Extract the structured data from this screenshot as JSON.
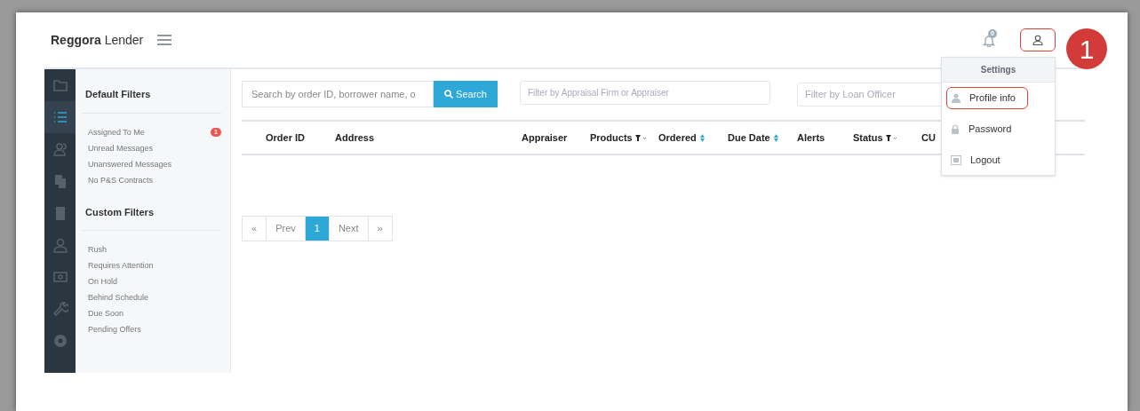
{
  "header": {
    "brand_bold": "Reggora",
    "brand_light": "Lender",
    "notification_count": "0"
  },
  "rail": [
    {
      "selected": false
    },
    {
      "selected": true
    },
    {
      "selected": false
    },
    {
      "selected": false
    },
    {
      "selected": false
    },
    {
      "selected": false
    },
    {
      "selected": false
    },
    {
      "selected": false
    },
    {
      "selected": false
    }
  ],
  "filters": {
    "default_title": "Default Filters",
    "default_items": [
      {
        "label": "Assigned To Me",
        "badge": "1"
      },
      {
        "label": "Unread Messages"
      },
      {
        "label": "Unanswered Messages"
      },
      {
        "label": "No P&S Contracts"
      }
    ],
    "custom_title": "Custom Filters",
    "custom_items": [
      {
        "label": "Rush"
      },
      {
        "label": "Requires Attention"
      },
      {
        "label": "On Hold"
      },
      {
        "label": "Behind Schedule"
      },
      {
        "label": "Due Soon"
      },
      {
        "label": "Pending Offers"
      }
    ]
  },
  "search": {
    "placeholder": "Search by order ID, borrower name, o",
    "button": "Search"
  },
  "appraiser_filter": {
    "placeholder": "Filter by Appraisal Firm or Appraiser"
  },
  "officer_filter": {
    "placeholder": "Filter by Loan Officer"
  },
  "table": {
    "columns": [
      {
        "label": "Order ID",
        "kind": "plain"
      },
      {
        "label": "Address",
        "kind": "plain"
      },
      {
        "label": "Appraiser",
        "kind": "plain"
      },
      {
        "label": "Products",
        "kind": "filter"
      },
      {
        "label": "Ordered",
        "kind": "sort"
      },
      {
        "label": "Due Date",
        "kind": "sort"
      },
      {
        "label": "Alerts",
        "kind": "plain"
      },
      {
        "label": "Status",
        "kind": "filter"
      },
      {
        "label": "CU",
        "kind": "plain"
      }
    ]
  },
  "pagination": [
    {
      "label": "«",
      "selected": false
    },
    {
      "label": "Prev",
      "selected": false
    },
    {
      "label": "1",
      "selected": true
    },
    {
      "label": "Next",
      "selected": false
    },
    {
      "label": "»",
      "selected": false
    }
  ],
  "menu": {
    "title": "Settings",
    "items": [
      {
        "label": "Profile info",
        "kind": "profile",
        "highlighted": true
      },
      {
        "label": "Password",
        "kind": "lock",
        "highlighted": false
      },
      {
        "label": "Logout",
        "kind": "logout",
        "highlighted": false
      }
    ]
  },
  "profile_button": {
    "highlighted": true
  },
  "callout": "1"
}
